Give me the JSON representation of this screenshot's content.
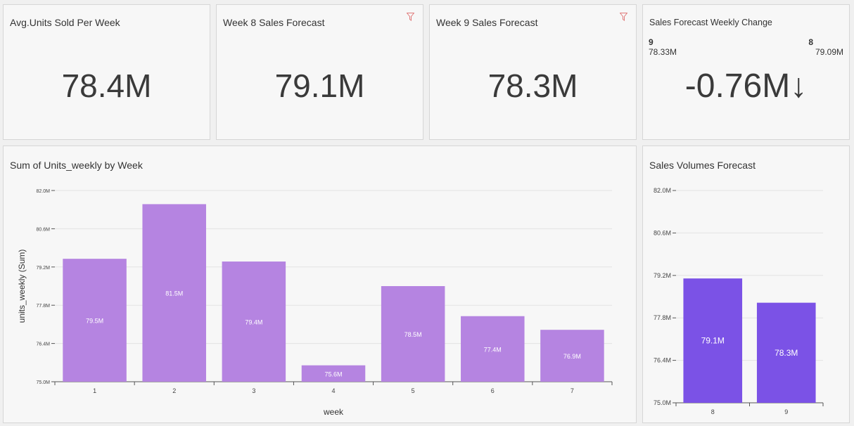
{
  "kpis": [
    {
      "title": "Avg.Units Sold Per Week",
      "value": "78.4M"
    },
    {
      "title": "Week 8 Sales Forecast",
      "value": "79.1M"
    },
    {
      "title": "Week 9 Sales Forecast",
      "value": "78.3M"
    }
  ],
  "change": {
    "title": "Sales Forecast Weekly Change",
    "left_week": "9",
    "left_value": "78.33M",
    "right_week": "8",
    "right_value": "79.09M",
    "value": "-0.76M",
    "arrow": "↓"
  },
  "colors": {
    "bar_weekly": "#b584e1",
    "bar_forecast": "#7b52e6",
    "filter_icon": "#e07a7a"
  },
  "icons": {
    "filter": "filter-icon"
  },
  "chart_data": [
    {
      "type": "bar",
      "title": "Sum of Units_weekly by Week",
      "xlabel": "week",
      "ylabel": "units_weekly (Sum)",
      "categories": [
        "1",
        "2",
        "3",
        "4",
        "5",
        "6",
        "7"
      ],
      "values": [
        79.5,
        81.5,
        79.4,
        75.6,
        78.5,
        77.4,
        76.9
      ],
      "data_labels": [
        "79.5M",
        "81.5M",
        "79.4M",
        "75.6M",
        "78.5M",
        "77.4M",
        "76.9M"
      ],
      "yticks": [
        "75.0M",
        "76.4M",
        "77.8M",
        "79.2M",
        "80.6M",
        "82.0M"
      ],
      "ylim": [
        75.0,
        82.0
      ],
      "grid": true
    },
    {
      "type": "bar",
      "title": "Sales Volumes Forecast",
      "xlabel": "",
      "ylabel": "",
      "categories": [
        "8",
        "9"
      ],
      "values": [
        79.1,
        78.3
      ],
      "data_labels": [
        "79.1M",
        "78.3M"
      ],
      "yticks": [
        "75.0M",
        "76.4M",
        "77.8M",
        "79.2M",
        "80.6M",
        "82.0M"
      ],
      "ylim": [
        75.0,
        82.0
      ],
      "grid": true
    }
  ]
}
